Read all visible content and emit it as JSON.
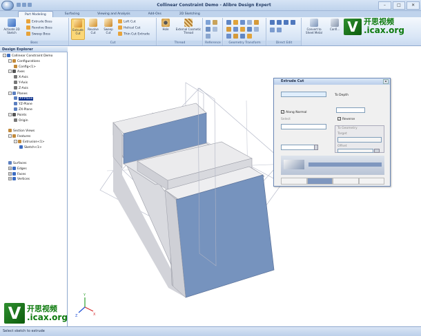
{
  "window": {
    "title": "Collinear Constraint Demo - Alibre Design Expert",
    "controls": [
      "–",
      "□",
      "✕"
    ]
  },
  "tabs": [
    "Part Modeling",
    "Surfacing",
    "Viewing and Analysis",
    "Add-Ons",
    "2D Sketching"
  ],
  "ribbon": {
    "activate": "Activate 2D Sketch",
    "extrude_boss": "Extrude Boss",
    "revolve_boss": "Revolve Boss",
    "sweep_boss": "Sweep Boss",
    "extrude_cut": "Extrude Cut",
    "revolve_cut": "Revolve Cut",
    "sweep_cut": "Sweep Cut",
    "loft_cut": "Loft Cut",
    "helical_cut": "Helical Cut",
    "thin_cut_extrude": "Thin Cut Extrude",
    "hole": "Hole",
    "external_thread": "External Cosmetic Thread",
    "convert_sheet_metal": "Convert to Sheet Metal",
    "configure": "Confi...",
    "groups": [
      "Boss",
      "Cut",
      "Thread",
      "Reference",
      "Geometry Transform",
      "Direct Edit"
    ]
  },
  "explorer": {
    "title": "Design Explorer",
    "nodes": [
      {
        "label": "Collinear Constraint Demo",
        "level": 0,
        "expander": "-",
        "icon": "#3b6cc2"
      },
      {
        "label": "Configurations",
        "level": 1,
        "expander": "-",
        "icon": "#c28a3b"
      },
      {
        "label": "Config<1>",
        "level": 2,
        "expander": "",
        "icon": "#c28a3b"
      },
      {
        "label": "Axes",
        "level": 1,
        "expander": "-",
        "icon": "#555555"
      },
      {
        "label": "X-Axis",
        "level": 2,
        "expander": "",
        "icon": "#777777"
      },
      {
        "label": "Y-Axis",
        "level": 2,
        "expander": "",
        "icon": "#777777"
      },
      {
        "label": "Z-Axis",
        "level": 2,
        "expander": "",
        "icon": "#777777"
      },
      {
        "label": "Planes",
        "level": 1,
        "expander": "-",
        "icon": "#5b7fc0"
      },
      {
        "label": "XY-Plane",
        "level": 2,
        "expander": "",
        "icon": "#5b7fc0",
        "selected": true
      },
      {
        "label": "YZ-Plane",
        "level": 2,
        "expander": "",
        "icon": "#5b7fc0"
      },
      {
        "label": "ZX-Plane",
        "level": 2,
        "expander": "",
        "icon": "#5b7fc0"
      },
      {
        "label": "Points",
        "level": 1,
        "expander": "-",
        "icon": "#555555"
      },
      {
        "label": "Origin",
        "level": 2,
        "expander": "",
        "icon": "#777777"
      },
      {
        "label": "",
        "level": 1,
        "expander": "",
        "icon": ""
      },
      {
        "label": "Section Views",
        "level": 1,
        "expander": "",
        "icon": "#c28a3b"
      },
      {
        "label": "Features",
        "level": 1,
        "expander": "-",
        "icon": "#c28a3b"
      },
      {
        "label": "Extrusion<1>",
        "level": 2,
        "expander": "-",
        "icon": "#c28a3b"
      },
      {
        "label": "Sketch<1>",
        "level": 3,
        "expander": "",
        "icon": "#3b6cc2"
      },
      {
        "label": "",
        "level": 1,
        "expander": "",
        "icon": ""
      },
      {
        "label": "",
        "level": 1,
        "expander": "",
        "icon": ""
      },
      {
        "label": "Surfaces",
        "level": 1,
        "expander": "",
        "icon": "#5b7fc0"
      },
      {
        "label": "Edges",
        "level": 1,
        "expander": "+",
        "icon": "#3b6cc2"
      },
      {
        "label": "Faces",
        "level": 1,
        "expander": "+",
        "icon": "#3b6cc2"
      },
      {
        "label": "Vertices",
        "level": 1,
        "expander": "+",
        "icon": "#3b6cc2"
      }
    ]
  },
  "dialog": {
    "title": "Extrude Cut",
    "close": "✕",
    "to_depth": "To Depth",
    "along_normal": "Along Normal",
    "select": "Select",
    "reverse": "Reverse",
    "to_geometry": "To Geometry",
    "target": "Target",
    "offset": "Offset"
  },
  "status": "Select sketch to extrude",
  "watermark": {
    "v": "V",
    "cn": "开思视频",
    "url": ".icax.org"
  },
  "triad": {
    "x": "X",
    "y": "Y",
    "z": "Z"
  },
  "colors": {
    "face_selected": "#7693be",
    "face_light": "#ebebed",
    "face_mid": "#d9dadf",
    "face_dark": "#c5c6cc",
    "accent": "#3b6cc2"
  }
}
